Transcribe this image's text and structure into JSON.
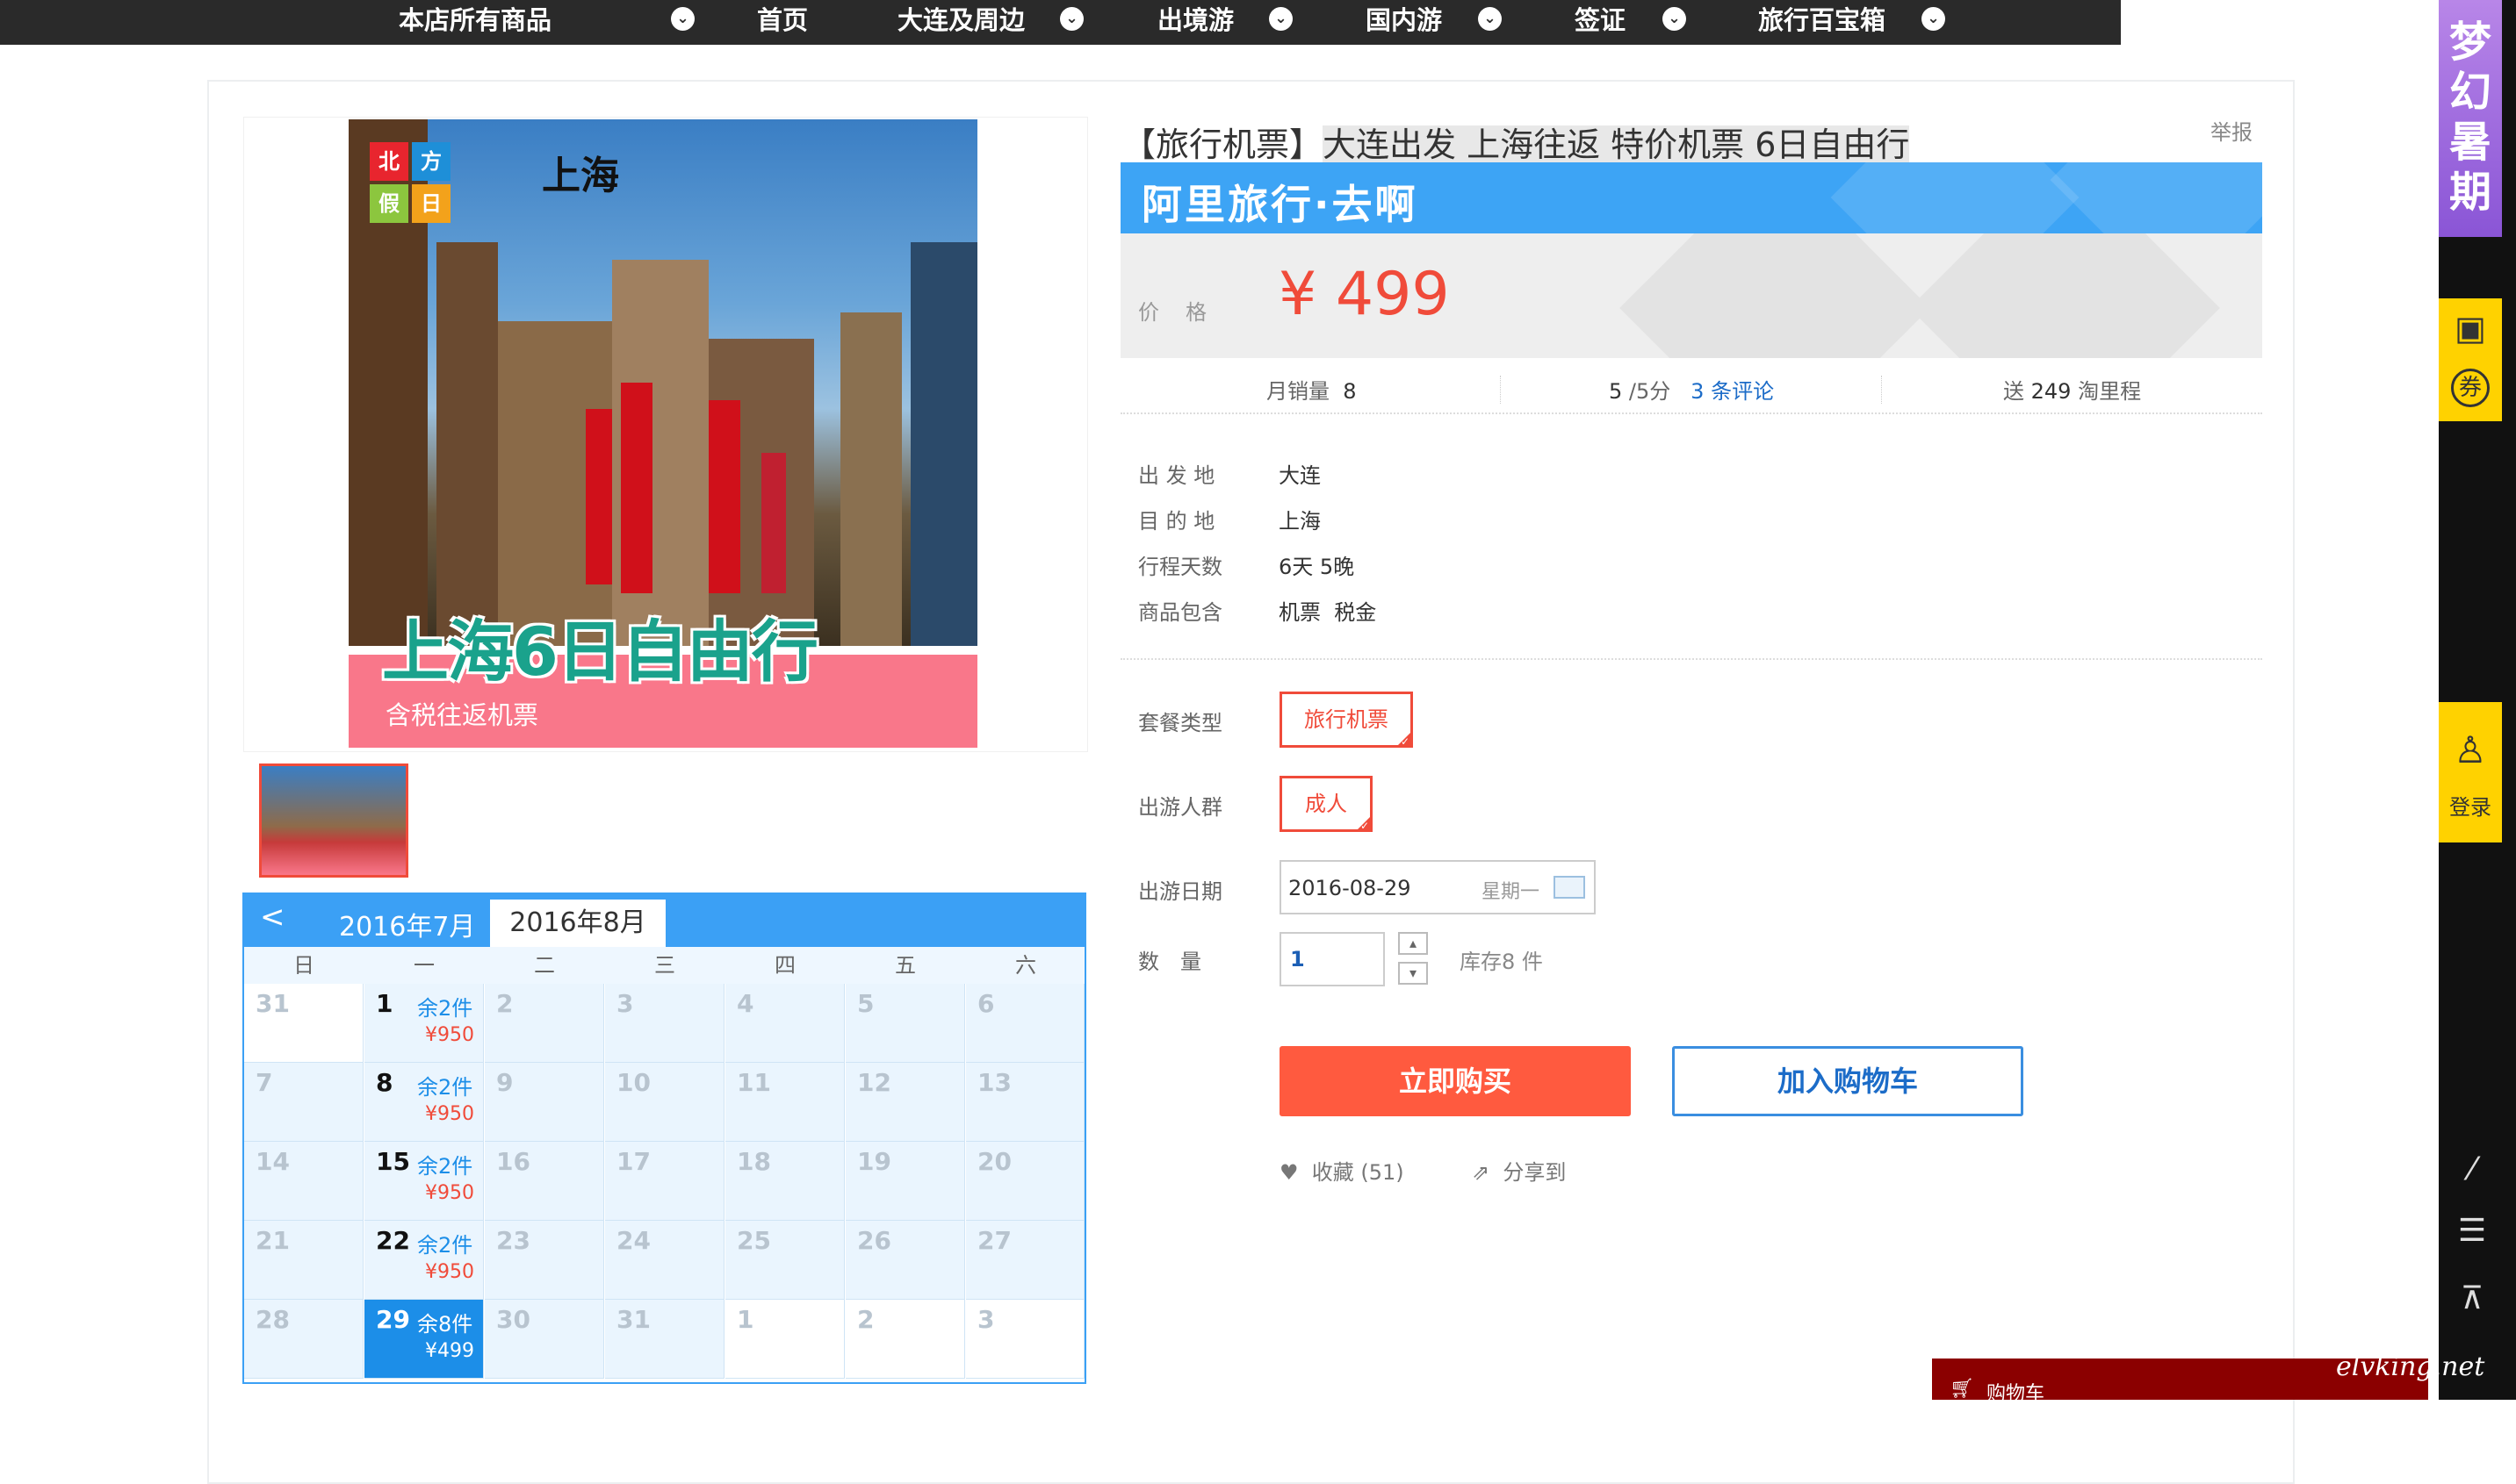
{
  "nav": {
    "all_products": "本店所有商品",
    "home": "首页",
    "dalian": "大连及周边",
    "outbound": "出境游",
    "domestic": "国内游",
    "visa": "签证",
    "treasure": "旅行百宝箱",
    "chevron": "⌄"
  },
  "sidebar": {
    "promo": "梦幻暑期",
    "login": "登录",
    "coupon_icon": "券"
  },
  "product": {
    "image": {
      "logo": [
        "北",
        "方",
        "假",
        "日"
      ],
      "city": "上海",
      "headline": "上海6日自由行",
      "subline": "含税往返机票"
    },
    "title_prefix": "【旅行机票】",
    "title_main": "大连出发 上海往返 特价机票 6日自由行",
    "report": "举报",
    "banner": "阿里旅行·去啊",
    "price_label": "价格",
    "price": "¥ 499",
    "stats": {
      "monthly_label": "月销量",
      "monthly_value": "8",
      "score": "5",
      "score_suffix": "/5分",
      "reviews": "3 条评论",
      "mileage_prefix": "送",
      "mileage_value": "249",
      "mileage_suffix": "淘里程"
    },
    "info": [
      {
        "label": "出 发 地",
        "value": "大连"
      },
      {
        "label": "目 的 地",
        "value": "上海"
      },
      {
        "label": "行程天数",
        "value": "6天 5晚"
      },
      {
        "label": "商品包含",
        "value": "机票  税金"
      }
    ],
    "options": {
      "package_label": "套餐类型",
      "package_value": "旅行机票",
      "group_label": "出游人群",
      "group_value": "成人",
      "date_label": "出游日期",
      "date_value": "2016-08-29",
      "date_weekday": "星期一",
      "qty_label": "数　量",
      "qty_value": "1",
      "stock": "库存8 件"
    },
    "buy_now": "立即购买",
    "add_cart": "加入购物车",
    "favorite": "收藏 (51)",
    "share": "分享到"
  },
  "calendar": {
    "prev": "<",
    "tab_prev": "2016年7月",
    "tab_current": "2016年8月",
    "weekdays": [
      "日",
      "一",
      "二",
      "三",
      "四",
      "五",
      "六"
    ],
    "rows": [
      [
        {
          "d": "31"
        },
        {
          "d": "1",
          "stock": "余2件",
          "price": "¥950"
        },
        {
          "d": "2"
        },
        {
          "d": "3"
        },
        {
          "d": "4"
        },
        {
          "d": "5"
        },
        {
          "d": "6"
        }
      ],
      [
        {
          "d": "7"
        },
        {
          "d": "8",
          "stock": "余2件",
          "price": "¥950"
        },
        {
          "d": "9"
        },
        {
          "d": "10"
        },
        {
          "d": "11"
        },
        {
          "d": "12"
        },
        {
          "d": "13"
        }
      ],
      [
        {
          "d": "14"
        },
        {
          "d": "15",
          "stock": "余2件",
          "price": "¥950"
        },
        {
          "d": "16"
        },
        {
          "d": "17"
        },
        {
          "d": "18"
        },
        {
          "d": "19"
        },
        {
          "d": "20"
        }
      ],
      [
        {
          "d": "21"
        },
        {
          "d": "22",
          "stock": "余2件",
          "price": "¥950"
        },
        {
          "d": "23"
        },
        {
          "d": "24"
        },
        {
          "d": "25"
        },
        {
          "d": "26"
        },
        {
          "d": "27"
        }
      ],
      [
        {
          "d": "28"
        },
        {
          "d": "29",
          "stock": "余8件",
          "price": "¥499"
        },
        {
          "d": "30"
        },
        {
          "d": "31"
        },
        {
          "d": "1"
        },
        {
          "d": "2"
        },
        {
          "d": "3"
        }
      ]
    ]
  },
  "mini_cart": "购物车",
  "watermark": "elvking.net",
  "colors": {
    "nav_bg": "#2a2a2a",
    "accent_blue": "#3ba0f5",
    "accent_red": "#f04b3a",
    "buy_button": "#ff5a3f",
    "sidebar_yellow": "#ffd200",
    "promo_purple": "#a06ee0"
  }
}
